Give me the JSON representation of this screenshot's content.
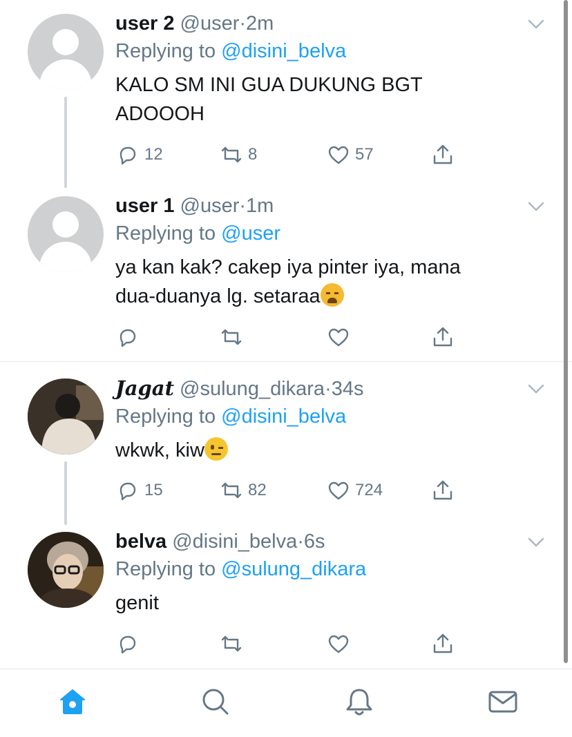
{
  "tweets": [
    {
      "name": "user 2",
      "handle": "@user",
      "dot": "·",
      "time": "2m",
      "replying_prefix": "Replying to ",
      "replying_to": "@disini_belva",
      "text_line1": "KALO SM INI GUA DUKUNG BGT",
      "text_line2": "ADOOOH",
      "replies": "12",
      "retweets": "8",
      "likes": "57"
    },
    {
      "name": "user 1",
      "handle": "@user",
      "dot": "·",
      "time": "1m",
      "replying_prefix": "Replying to ",
      "replying_to": "@user",
      "text_line1": "ya kan kak? cakep iya pinter iya, mana",
      "text_line2": "dua-duanya lg. setaraa",
      "emoji": "weary-face-emoji",
      "replies": "",
      "retweets": "",
      "likes": ""
    },
    {
      "name": "𝑱agat",
      "handle": "@sulung_dikara",
      "dot": "·",
      "time": "34s",
      "replying_prefix": "Replying to ",
      "replying_to": "@disini_belva",
      "text_line1": "wkwk, kiw",
      "emoji": "winking-face-emoji",
      "replies": "15",
      "retweets": "82",
      "likes": "724"
    },
    {
      "name": "belva",
      "handle": "@disini_belva",
      "dot": "·",
      "time": "6s",
      "replying_prefix": "Replying to ",
      "replying_to": "@sulung_dikara",
      "text_line1": "genit",
      "replies": "",
      "retweets": "",
      "likes": ""
    }
  ],
  "tabbar": {
    "tabs": [
      "home-icon",
      "search-icon",
      "notifications-icon",
      "messages-icon"
    ],
    "active": "home-icon"
  },
  "colors": {
    "accent": "#1da1f2",
    "secondary_text": "#657786",
    "primary_text": "#14171a",
    "divider": "#e1e8ed",
    "thread_line": "#ccd6dd"
  }
}
